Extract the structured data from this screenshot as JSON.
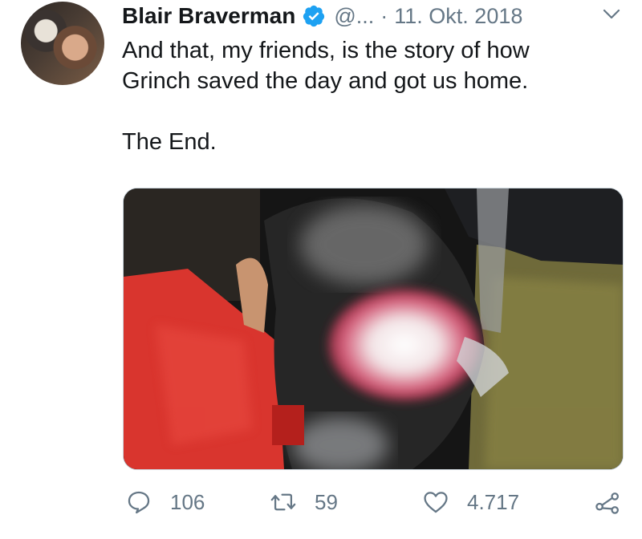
{
  "tweet": {
    "author_name": "Blair Braverman",
    "handle": "@...",
    "separator": "·",
    "date": "11. Okt. 2018",
    "lines": [
      "And that, my friends, is the story of how",
      "Grinch saved the day and got us home."
    ],
    "closing": "The End.",
    "icons": {
      "verified": "verified-badge-icon",
      "menu": "chevron-down-icon",
      "reply": "reply-icon",
      "retweet": "retweet-icon",
      "like": "heart-icon",
      "share": "share-icon"
    },
    "counts": {
      "replies": "106",
      "retweets": "59",
      "likes": "4.717"
    },
    "colors": {
      "verified": "#1da1f2",
      "secondary_text": "#657786",
      "primary_text": "#14171a"
    }
  }
}
